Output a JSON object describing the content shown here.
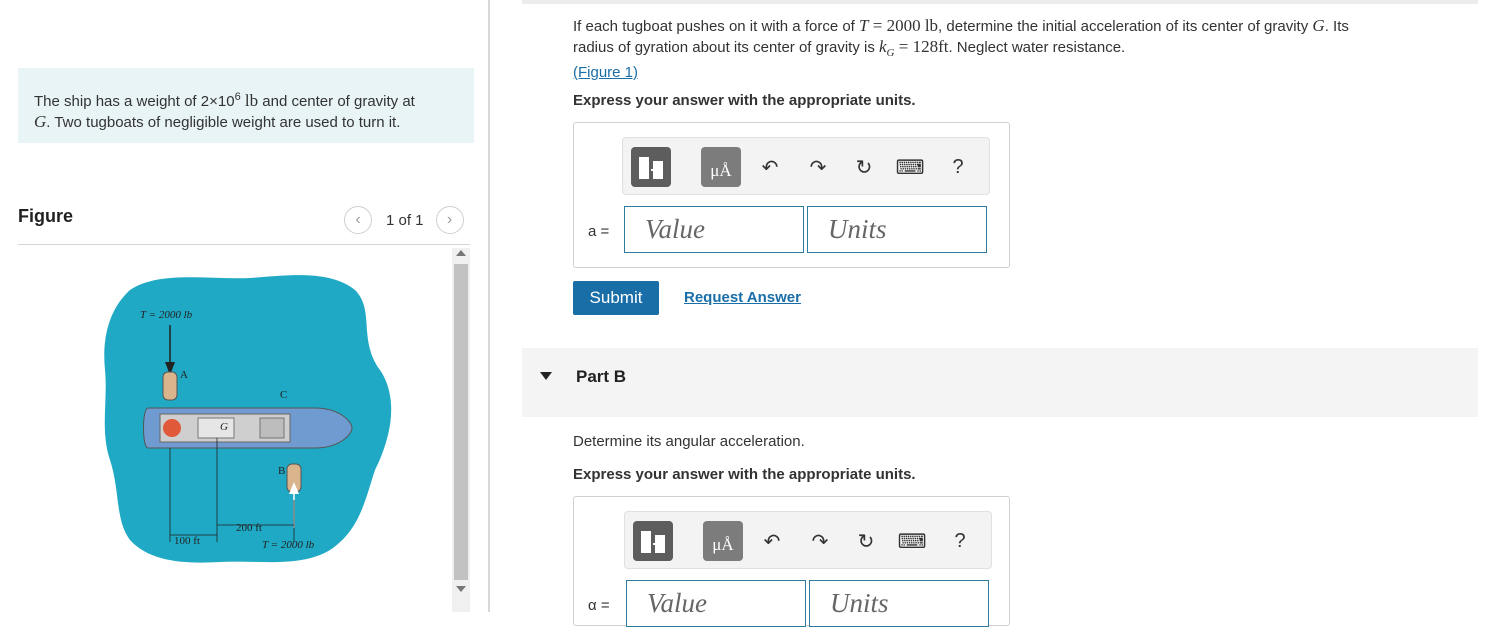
{
  "intro": {
    "line1_pre": "The ship has a weight of 2×10",
    "line1_exp": "6",
    "line1_unit": "lb",
    "line1_post": " and center of gravity at",
    "line2_var": "G",
    "line2_post": ". Two tugboats of negligible weight are used to turn it."
  },
  "figure": {
    "label": "Figure",
    "pager_text": "1 of 1",
    "prev_glyph": "‹",
    "next_glyph": "›",
    "top_force": "T = 2000 lb",
    "bottom_force": "T = 2000 lb",
    "dim_200": "200 ft",
    "dim_100": "100 ft",
    "point_a": "A",
    "point_b": "B",
    "point_c": "C",
    "point_g": "G",
    "water_color": "#1fa9c4"
  },
  "question": {
    "part1": "If each tugboat pushes on it with a force of ",
    "t_var": "T",
    "t_val": " = 2000 lb",
    "part2": ", determine the initial acceleration of its center of gravity ",
    "g_var": "G",
    "part3": ". Its",
    "part4": "radius of gyration about its center of gravity is ",
    "k_var": "k",
    "k_sub": "G",
    "k_val": " = 128ft",
    "part5": ". Neglect water resistance.",
    "figure_link": "(Figure 1)"
  },
  "express_units": "Express your answer with the appropriate units.",
  "part_a": {
    "var_label": "a =",
    "value_placeholder": "Value",
    "units_placeholder": "Units",
    "submit_label": "Submit",
    "request_answer": "Request Answer"
  },
  "part_b": {
    "title": "Part B",
    "question": "Determine its angular acceleration.",
    "express_units": "Express your answer with the appropriate units.",
    "var_label": "α =",
    "value_placeholder": "Value",
    "units_placeholder": "Units"
  },
  "toolbar": {
    "mu_label": "μÅ",
    "help_label": "?",
    "undo_glyph": "↶",
    "redo_glyph": "↷",
    "reset_glyph": "↻",
    "keyboard_glyph": "⌨"
  },
  "colors": {
    "accent": "#1a6ea8",
    "intro_bg": "#e8f4f6",
    "field_border": "#2e7ca0"
  }
}
